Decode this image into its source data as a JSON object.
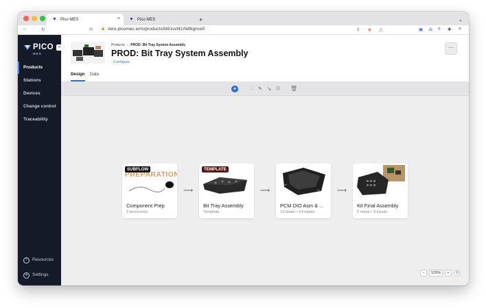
{
  "browser": {
    "tabs": [
      {
        "label": "Pico MES"
      },
      {
        "label": "Pico MES"
      }
    ],
    "url": "zero.picomes.io/m/products/bt61vvf41rfelfkgnce0"
  },
  "sidebar": {
    "logo": "PICO",
    "logo_sub": "MES",
    "items": [
      {
        "label": "Products"
      },
      {
        "label": "Stations"
      },
      {
        "label": "Devices"
      },
      {
        "label": "Change control"
      },
      {
        "label": "Traceability"
      }
    ],
    "bottom": [
      {
        "label": "Resources"
      },
      {
        "label": "Settings"
      }
    ]
  },
  "header": {
    "breadcrumb_root": "Products",
    "breadcrumb_sep": "›",
    "breadcrumb_current": "PROD: Bit Tray System Assembly",
    "title": "PROD: Bit Tray System Assembly",
    "configure": "Configure",
    "more": "···",
    "tabs": [
      {
        "label": "Design"
      },
      {
        "label": "Data"
      }
    ]
  },
  "flow": {
    "cards": [
      {
        "badge": "SUBFLOW",
        "name": "Component Prep",
        "sub": "5 processes",
        "image_text": "PREPARATION"
      },
      {
        "badge": "TEMPLATE",
        "name": "Bit Tray Assembly",
        "sub": "Template"
      },
      {
        "name": "PCM DIO Asm & ...",
        "sub": "13 steps • 14 inputs"
      },
      {
        "name": "Kit Final Assembly",
        "sub": "6 steps • 9 inputs"
      }
    ]
  },
  "zoom": {
    "minus": "−",
    "value": "125%",
    "plus": "+"
  },
  "colors": {
    "sidebar_bg": "#141a27",
    "accent": "#2b6cd8",
    "subflow_badge": "#111111",
    "template_badge": "#5a1512"
  }
}
